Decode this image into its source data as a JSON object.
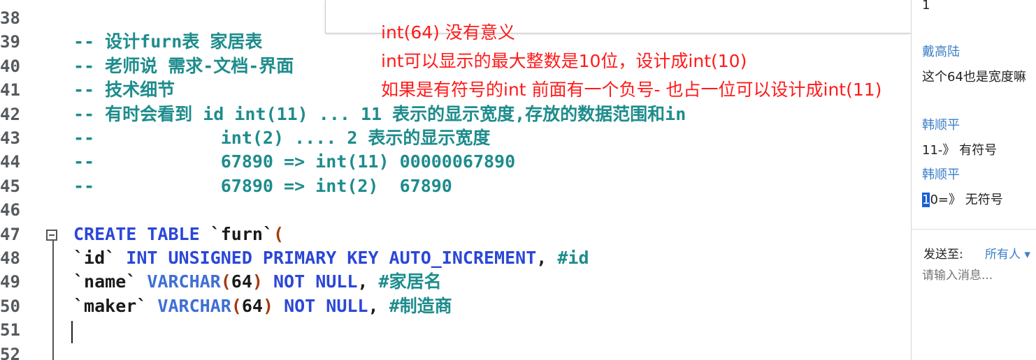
{
  "editor": {
    "lines": [
      {
        "n": "38",
        "parts": []
      },
      {
        "n": "39",
        "parts": [
          {
            "c": "c-comment",
            "t": "-- 设计furn表 家居表"
          }
        ]
      },
      {
        "n": "40",
        "parts": [
          {
            "c": "c-comment",
            "t": "-- 老师说 需求-文档-界面"
          }
        ]
      },
      {
        "n": "41",
        "parts": [
          {
            "c": "c-comment",
            "t": "-- 技术细节"
          }
        ]
      },
      {
        "n": "42",
        "parts": [
          {
            "c": "c-comment",
            "t": "-- 有时会看到 id int(11) ... 11 表示的显示宽度,存放的数据范围和in"
          }
        ]
      },
      {
        "n": "43",
        "parts": [
          {
            "c": "c-comment",
            "t": "--            int(2) .... 2 表示的显示宽度"
          }
        ]
      },
      {
        "n": "44",
        "parts": [
          {
            "c": "c-comment",
            "t": "--            67890 => int(11) 00000067890"
          }
        ]
      },
      {
        "n": "45",
        "parts": [
          {
            "c": "c-comment",
            "t": "--            67890 => int(2)  67890"
          }
        ]
      },
      {
        "n": "46",
        "parts": []
      },
      {
        "n": "47",
        "parts": [
          {
            "c": "c-kw",
            "t": "CREATE TABLE "
          },
          {
            "c": "c-str",
            "t": "`furn`"
          },
          {
            "c": "c-paren",
            "t": "("
          }
        ]
      },
      {
        "n": "48",
        "parts": [
          {
            "c": "c-str",
            "t": "`id` "
          },
          {
            "c": "c-kw",
            "t": "INT UNSIGNED PRIMARY KEY AUTO_INCREMENT"
          },
          {
            "c": "c-plain",
            "t": ", "
          },
          {
            "c": "c-hash",
            "t": "#id"
          }
        ]
      },
      {
        "n": "49",
        "parts": [
          {
            "c": "c-str",
            "t": "`name` "
          },
          {
            "c": "c-type",
            "t": "VARCHAR"
          },
          {
            "c": "c-paren",
            "t": "("
          },
          {
            "c": "c-plain",
            "t": "64"
          },
          {
            "c": "c-paren",
            "t": ")"
          },
          {
            "c": "c-kw",
            "t": " NOT NULL"
          },
          {
            "c": "c-plain",
            "t": ", "
          },
          {
            "c": "c-hash",
            "t": "#家居名"
          }
        ]
      },
      {
        "n": "50",
        "parts": [
          {
            "c": "c-str",
            "t": "`maker` "
          },
          {
            "c": "c-type",
            "t": "VARCHAR"
          },
          {
            "c": "c-paren",
            "t": "("
          },
          {
            "c": "c-plain",
            "t": "64"
          },
          {
            "c": "c-paren",
            "t": ")"
          },
          {
            "c": "c-kw",
            "t": " NOT NULL"
          },
          {
            "c": "c-plain",
            "t": ", "
          },
          {
            "c": "c-hash",
            "t": "#制造商"
          }
        ]
      },
      {
        "n": "51",
        "parts": []
      },
      {
        "n": "52",
        "parts": []
      }
    ]
  },
  "notes": {
    "line1": "int(64) 没有意义",
    "line2": "int可以显示的最大整数是10位，设计成int(10)",
    "line3": "如果是有符号的int 前面有一个负号- 也占一位可以设计成int(11)"
  },
  "chat": {
    "top_text": "1",
    "messages": [
      {
        "name": "戴高陆",
        "text": "这个64也是宽度嘛"
      },
      {
        "name": "韩顺平",
        "text": "11-》 有符号"
      },
      {
        "name": "韩顺平",
        "text_sel": "1",
        "text_rest": "0=》 无符号"
      }
    ],
    "send_label": "发送至:",
    "send_target": "所有人 ▾",
    "input_placeholder": "请输入消息..."
  }
}
